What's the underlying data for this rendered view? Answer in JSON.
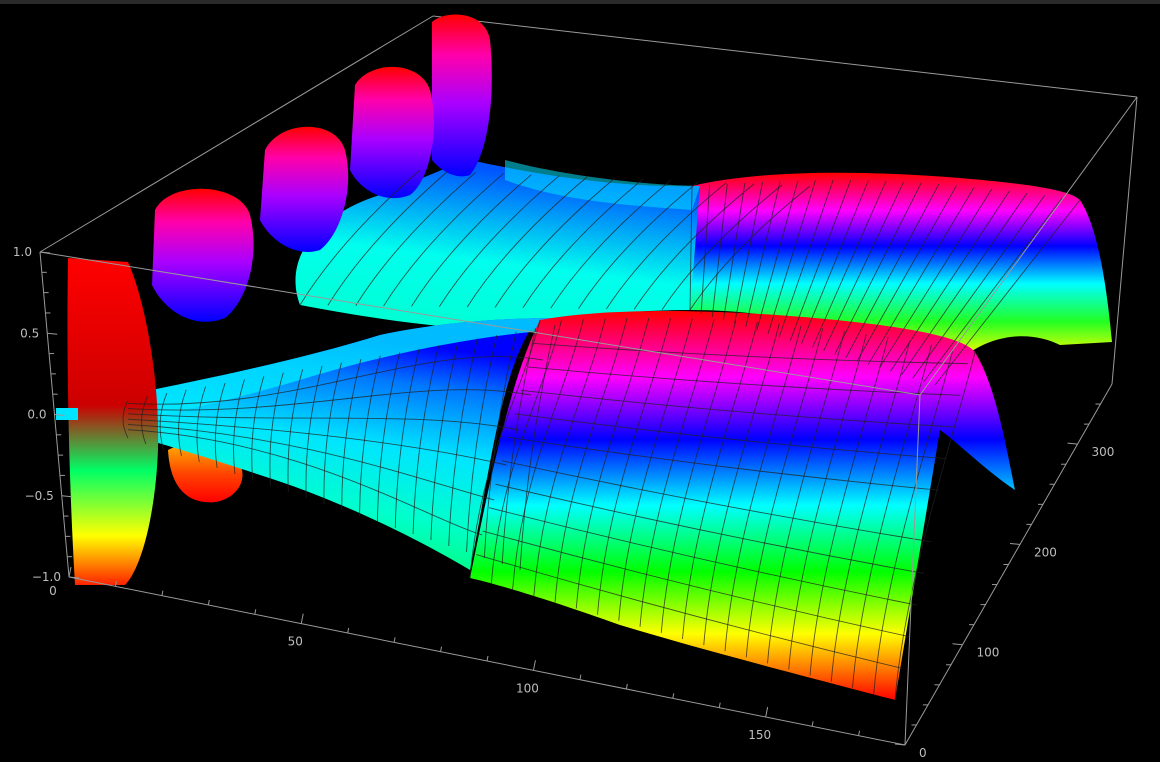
{
  "chart_data": {
    "type": "surface3d",
    "title": "",
    "xlabel": "",
    "ylabel": "",
    "zlabel": "",
    "x_range": [
      0,
      180
    ],
    "y_range": [
      0,
      360
    ],
    "z_range": [
      -1.0,
      1.0
    ],
    "x_ticks": [
      "0",
      "50",
      "100",
      "150"
    ],
    "y_ticks": [
      "0",
      "100",
      "200",
      "300"
    ],
    "z_ticks": [
      "1.0",
      "0.5",
      "0.0",
      "−0.5",
      "−1.0"
    ],
    "colormap": "hue rainbow (red → yellow → green → cyan → blue → magenta → red)",
    "background": "#000000",
    "box_color": "#9a9a9a",
    "mesh": true,
    "description_of_values": "Surface z(x,y): two ridges near x≈105–170 with peak z≈1.0, a sag to z≈-0.2 near x≈35–95, and oscillating spikes near x≈0–30 reaching ±1.0",
    "ridge_peak_z": 1.0,
    "ridge_x_range": [
      105,
      170
    ]
  }
}
